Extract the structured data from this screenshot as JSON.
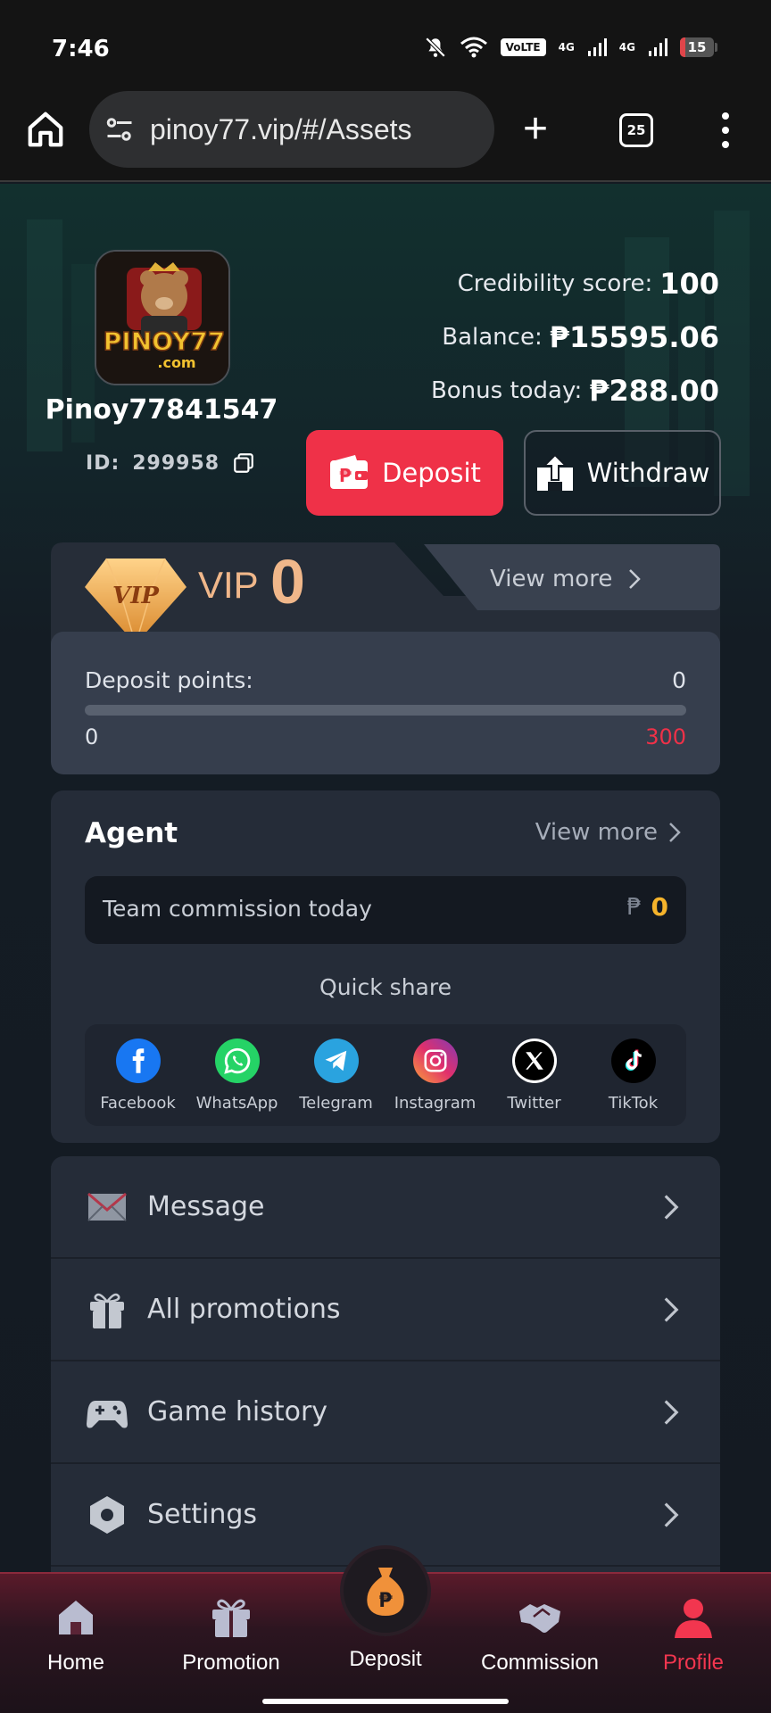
{
  "status": {
    "time": "7:46",
    "volte": "VoLTE",
    "network1": "4G",
    "network2": "4G",
    "battery": "15",
    "battery_level": 0.15
  },
  "browser": {
    "url": "pinoy77.vip/#/Assets",
    "tab_count": "25"
  },
  "profile": {
    "username": "Pinoy77841547",
    "id_label": "ID:",
    "id_value": "299958",
    "credibility_label": "Credibility score:",
    "credibility_value": "100",
    "balance_label": "Balance:",
    "balance_value": "₱15595.06",
    "bonus_label": "Bonus today:",
    "bonus_value": "₱288.00",
    "deposit_label": "Deposit",
    "withdraw_label": "Withdraw"
  },
  "vip": {
    "label": "VIP",
    "level": "0",
    "view_more": "View more",
    "deposit_points_label": "Deposit points:",
    "deposit_points_value": "0",
    "progress_min": "0",
    "progress_max": "300",
    "progress_fraction": 0
  },
  "agent": {
    "title": "Agent",
    "view_more": "View more",
    "commission_label": "Team commission today",
    "commission_currency": "₱",
    "commission_value": "0",
    "quick_share_title": "Quick share",
    "share": [
      {
        "label": "Facebook"
      },
      {
        "label": "WhatsApp"
      },
      {
        "label": "Telegram"
      },
      {
        "label": "Instagram"
      },
      {
        "label": "Twitter"
      },
      {
        "label": "TikTok"
      }
    ]
  },
  "menu": {
    "items": [
      {
        "label": "Message",
        "icon": "envelope-icon"
      },
      {
        "label": "All promotions",
        "icon": "gift-icon"
      },
      {
        "label": "Game history",
        "icon": "gamepad-icon"
      },
      {
        "label": "Settings",
        "icon": "hexagon-settings-icon"
      }
    ]
  },
  "nav": {
    "home": "Home",
    "promotion": "Promotion",
    "deposit": "Deposit",
    "commission": "Commission",
    "profile": "Profile",
    "active": "profile",
    "active_color": "#f2364f"
  },
  "colors": {
    "accent": "#ef3148",
    "vip_gold": "#f0b78a",
    "commission_gold": "#f5b32b"
  }
}
